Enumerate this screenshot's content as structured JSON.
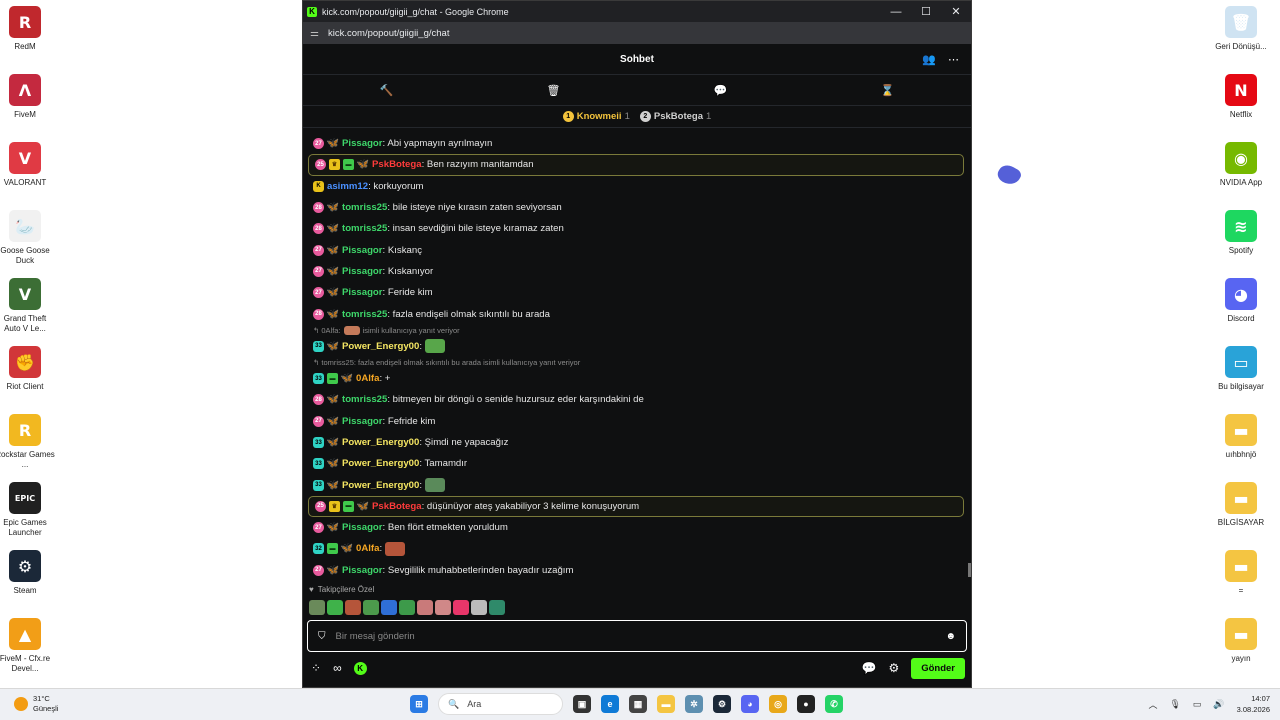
{
  "desktop_left": [
    {
      "label": "RedM",
      "color": "#c0282d",
      "glyph": "R"
    },
    {
      "label": "FiveM",
      "color": "#c4293f",
      "glyph": "Λ"
    },
    {
      "label": "VALORANT",
      "color": "#e03a44",
      "glyph": "V"
    },
    {
      "label": "Goose Goose Duck",
      "color": "#f1f1f1",
      "glyph": "🦢"
    },
    {
      "label": "Grand Theft Auto V Le...",
      "color": "#3c6e35",
      "glyph": "V"
    },
    {
      "label": "Riot Client",
      "color": "#d13639",
      "glyph": "✊"
    },
    {
      "label": "Rockstar Games ...",
      "color": "#f2b820",
      "glyph": "R"
    },
    {
      "label": "Epic Games Launcher",
      "color": "#202020",
      "glyph": "EPIC"
    },
    {
      "label": "Steam",
      "color": "#1b2838",
      "glyph": "⚙"
    },
    {
      "label": "FiveM - Cfx.re Devel...",
      "color": "#f29e17",
      "glyph": "▲"
    }
  ],
  "desktop_right": [
    {
      "label": "Geri Dönüşü...",
      "color": "#cfe3f2",
      "glyph": "🗑"
    },
    {
      "label": "Netflix",
      "color": "#e50914",
      "glyph": "N"
    },
    {
      "label": "NVIDIA App",
      "color": "#76b900",
      "glyph": "◉"
    },
    {
      "label": "Spotify",
      "color": "#1ed760",
      "glyph": "≋"
    },
    {
      "label": "Discord",
      "color": "#5865f2",
      "glyph": "◕"
    },
    {
      "label": "Bu bilgisayar",
      "color": "#29a3d8",
      "glyph": "▭"
    },
    {
      "label": "uıhbhnjö",
      "color": "#f4c542",
      "glyph": "▬"
    },
    {
      "label": "BİLGİSAYAR",
      "color": "#f4c542",
      "glyph": "▬"
    },
    {
      "label": "=",
      "color": "#f4c542",
      "glyph": "▬"
    },
    {
      "label": "yayın",
      "color": "#f4c542",
      "glyph": "▬"
    }
  ],
  "window": {
    "title": "kick.com/popout/giigii_g/chat - Google Chrome",
    "url": "kick.com/popout/giigii_g/chat",
    "minimize": "—",
    "maximize": "☐",
    "close": "✕"
  },
  "chat": {
    "header_title": "Sohbet",
    "podium": [
      {
        "rank": "1",
        "name": "Knowmeii",
        "count": "1",
        "color": "#f3c33c"
      },
      {
        "rank": "2",
        "name": "PskBotega",
        "count": "1",
        "color": "#d0d0d0"
      }
    ],
    "messages": [
      {
        "type": "msg",
        "badges": [
          "sub-p:27",
          "bfly:🦋"
        ],
        "user": "Pissagor",
        "color": "#3ed66a",
        "text": ": Abi yapmayın ayrılmayın"
      },
      {
        "type": "msg",
        "hl": true,
        "badges": [
          "sub-p:25",
          "crown:♛",
          "gift:▬",
          "bfly:🦋"
        ],
        "user": "PskBotega",
        "color": "#ff3b3b",
        "text": ": Ben razıyım manitamdan"
      },
      {
        "type": "msg",
        "badges": [
          "kick:K"
        ],
        "user": "asimm12",
        "color": "#4a90ff",
        "text": ": korkuyorum"
      },
      {
        "type": "msg",
        "badges": [
          "sub-p:28",
          "bfly:🦋"
        ],
        "user": "tomriss25",
        "color": "#3ed66a",
        "text": ": bile isteye niye kırasın zaten seviyorsan"
      },
      {
        "type": "msg",
        "badges": [
          "sub-p:28",
          "bfly:🦋"
        ],
        "user": "tomriss25",
        "color": "#3ed66a",
        "text": ": insan sevdiğini bile isteye kıramaz zaten"
      },
      {
        "type": "msg",
        "badges": [
          "sub-p:27",
          "bfly:🦋"
        ],
        "user": "Pissagor",
        "color": "#3ed66a",
        "text": ": Kıskanç"
      },
      {
        "type": "msg",
        "badges": [
          "sub-p:27",
          "bfly:🦋"
        ],
        "user": "Pissagor",
        "color": "#3ed66a",
        "text": ": Kıskanıyor"
      },
      {
        "type": "msg",
        "badges": [
          "sub-p:27",
          "bfly:🦋"
        ],
        "user": "Pissagor",
        "color": "#3ed66a",
        "text": ": Feride kim"
      },
      {
        "type": "msg",
        "badges": [
          "sub-p:28",
          "bfly:🦋"
        ],
        "user": "tomriss25",
        "color": "#3ed66a",
        "text": ": fazla endişeli olmak sıkıntılı bu arada"
      },
      {
        "type": "reply",
        "text": "↰ 0Alfa:",
        "emote": "#c47a5a",
        "text2": "isimli kullanıcıya yanıt veriyor"
      },
      {
        "type": "msg",
        "badges": [
          "sub-t:33",
          "bfly:🦋"
        ],
        "user": "Power_Energy00",
        "color": "#f5e663",
        "text": ":",
        "emote": "#58a64a"
      },
      {
        "type": "reply",
        "text": "↰ tomriss25: fazla endişeli olmak sıkıntılı bu arada isimli kullanıcıya yanıt veriyor"
      },
      {
        "type": "msg",
        "badges": [
          "sub-t:33",
          "gift:▬",
          "bfly:🦋"
        ],
        "user": "0Alfa",
        "color": "#f5a623",
        "text": ": +"
      },
      {
        "type": "msg",
        "badges": [
          "sub-p:28",
          "bfly:🦋"
        ],
        "user": "tomriss25",
        "color": "#3ed66a",
        "text": ": bitmeyen bir döngü o senide huzursuz eder karşındakini de"
      },
      {
        "type": "msg",
        "badges": [
          "sub-p:27",
          "bfly:🦋"
        ],
        "user": "Pissagor",
        "color": "#3ed66a",
        "text": ": Fefride kim"
      },
      {
        "type": "msg",
        "badges": [
          "sub-t:33",
          "bfly:🦋"
        ],
        "user": "Power_Energy00",
        "color": "#f5e663",
        "text": ": Şimdi ne yapacağız"
      },
      {
        "type": "msg",
        "badges": [
          "sub-t:33",
          "bfly:🦋"
        ],
        "user": "Power_Energy00",
        "color": "#f5e663",
        "text": ": Tamamdır"
      },
      {
        "type": "msg",
        "badges": [
          "sub-t:33",
          "bfly:🦋"
        ],
        "user": "Power_Energy00",
        "color": "#f5e663",
        "text": ":",
        "emote": "#5a8a5a"
      },
      {
        "type": "msg",
        "hl": true,
        "badges": [
          "sub-p:25",
          "crown:♛",
          "gift:▬",
          "bfly:🦋"
        ],
        "user": "PskBotega",
        "color": "#ff3b3b",
        "text": ": düşünüyor ateş yakabiliyor 3 kelime konuşuyorum"
      },
      {
        "type": "msg",
        "badges": [
          "sub-p:27",
          "bfly:🦋"
        ],
        "user": "Pissagor",
        "color": "#3ed66a",
        "text": ": Ben flört etmekten yoruldum"
      },
      {
        "type": "msg",
        "badges": [
          "sub-t:32",
          "gift:▬",
          "bfly:🦋"
        ],
        "user": "0Alfa",
        "color": "#f5a623",
        "text": ":",
        "emote": "#b5553a"
      },
      {
        "type": "msg",
        "badges": [
          "sub-p:27",
          "bfly:🦋"
        ],
        "user": "Pissagor",
        "color": "#3ed66a",
        "text": ": Sevgililik muhabbetlerinden bayadır uzağım"
      }
    ],
    "favorites_label": "Takipçilere Özel",
    "favorite_emotes": [
      "#6a8a5a",
      "#3fb24a",
      "#b5553a",
      "#4c9a4c",
      "#2f6fd6",
      "#3d9a4a",
      "#c97a7a",
      "#d08888",
      "#e8366a",
      "#bbbbbb",
      "#2f8a6a"
    ],
    "input_placeholder": "Bir mesaj gönderin",
    "send_label": "Gönder"
  },
  "taskbar": {
    "temp": "31°C",
    "weather": "Güneşli",
    "search_placeholder": "Ara",
    "time": "14:07",
    "date": "3.08.2026"
  },
  "colors": {
    "accent": "#53fc18",
    "chat_bg": "#0f1011"
  }
}
